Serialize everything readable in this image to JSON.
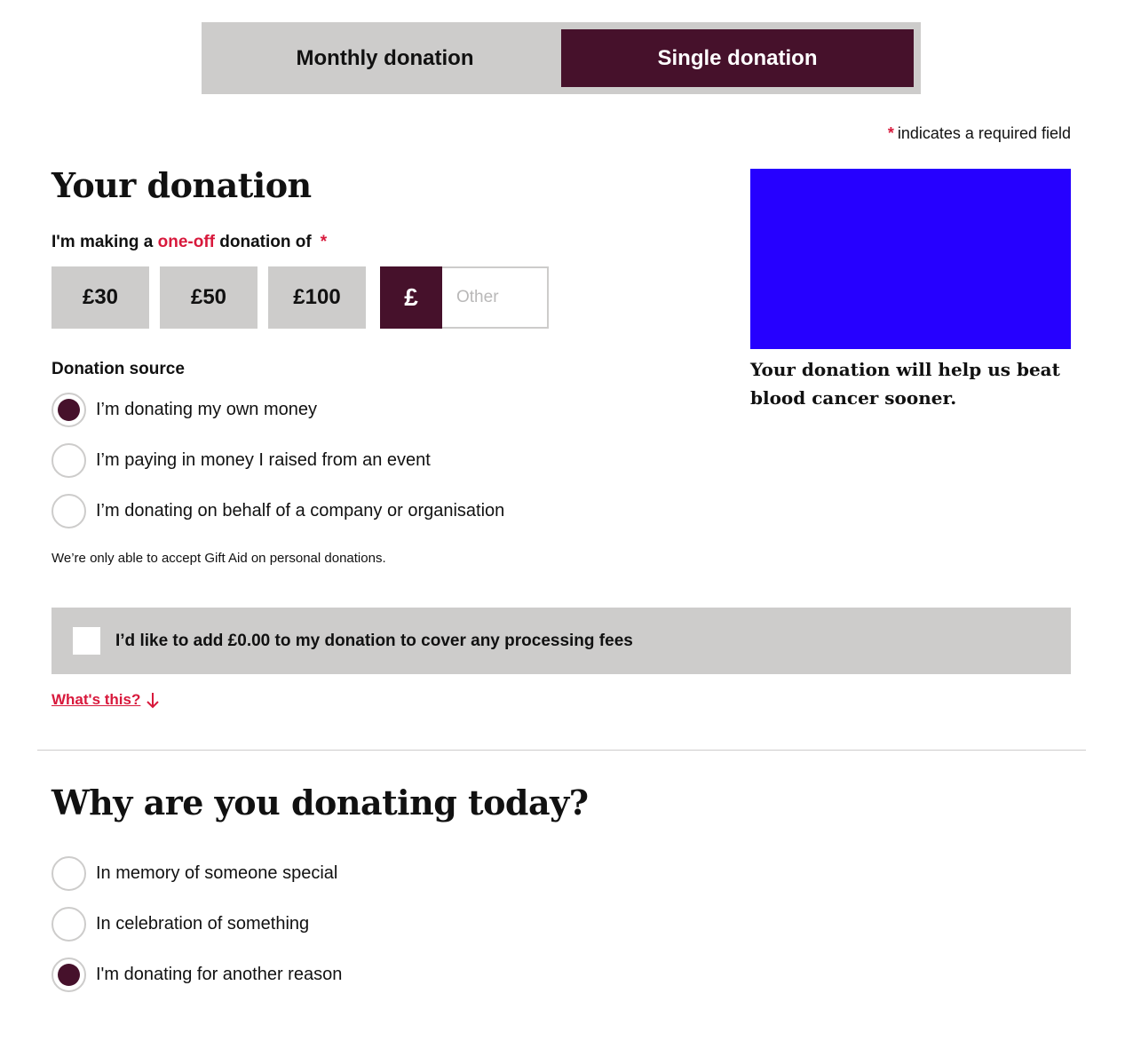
{
  "tabs": {
    "monthly": "Monthly donation",
    "single": "Single donation"
  },
  "required_note": {
    "star": "*",
    "text": "indicates a required field"
  },
  "donation": {
    "heading": "Your donation",
    "making_prefix": "I'm making a ",
    "making_accent": "one-off",
    "making_suffix": " donation of",
    "required_star": "*",
    "amounts": [
      "£30",
      "£50",
      "£100"
    ],
    "currency_symbol": "£",
    "other_placeholder": "Other",
    "other_value": ""
  },
  "source": {
    "label": "Donation source",
    "options": [
      {
        "label": "I’m donating my own money",
        "selected": true
      },
      {
        "label": "I’m paying in money I raised from an event",
        "selected": false
      },
      {
        "label": "I’m donating on behalf of a company or organisation",
        "selected": false
      }
    ],
    "gift_aid_note": "We’re only able to accept Gift Aid on personal donations."
  },
  "fees": {
    "label": "I’d like to add £0.00 to my donation to cover any processing fees",
    "checked": false
  },
  "whats_this": "What's this?",
  "why": {
    "heading": "Why are you donating today?",
    "options": [
      {
        "label": "In memory of someone special",
        "selected": false
      },
      {
        "label": "In celebration of something",
        "selected": false
      },
      {
        "label": "I'm donating for another reason",
        "selected": true
      }
    ]
  },
  "side": {
    "caption": "Your donation will help us beat blood cancer sooner."
  },
  "colors": {
    "brand": "#46112b",
    "accent": "#d8193c",
    "panel": "#cdcccb",
    "image_placeholder": "#2600ff"
  }
}
